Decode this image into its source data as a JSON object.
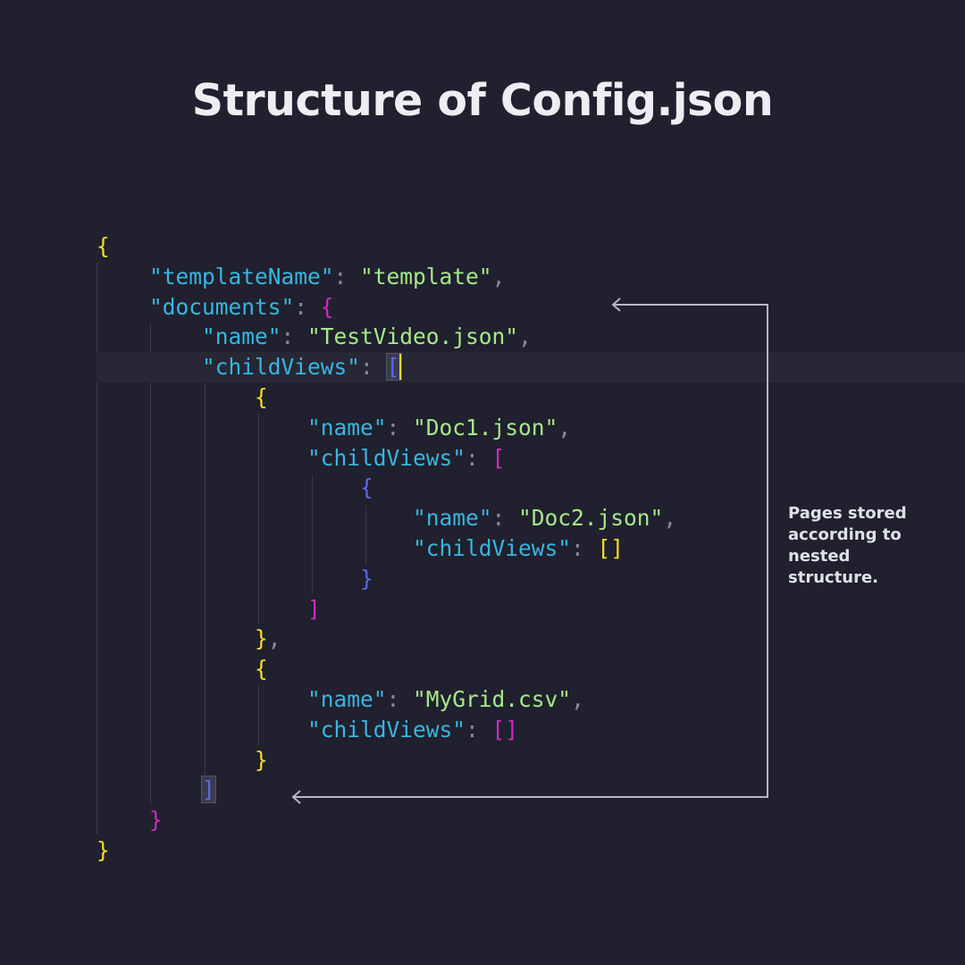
{
  "title": "Structure of Config.json",
  "annotation": "Pages stored according to nested structure.",
  "code": {
    "open_brace": "{",
    "close_brace": "}",
    "template_key": "\"templateName\"",
    "template_value": "\"template\"",
    "documents_key": "\"documents\"",
    "name_key": "\"name\"",
    "childviews_key": "\"childViews\"",
    "doc_root_name": "\"TestVideo.json\"",
    "doc1_name": "\"Doc1.json\"",
    "doc2_name": "\"Doc2.json\"",
    "grid_name": "\"MyGrid.csv\"",
    "open_bracket": "[",
    "close_bracket": "]",
    "empty_array": "[]",
    "colon": ": ",
    "comma": ","
  }
}
